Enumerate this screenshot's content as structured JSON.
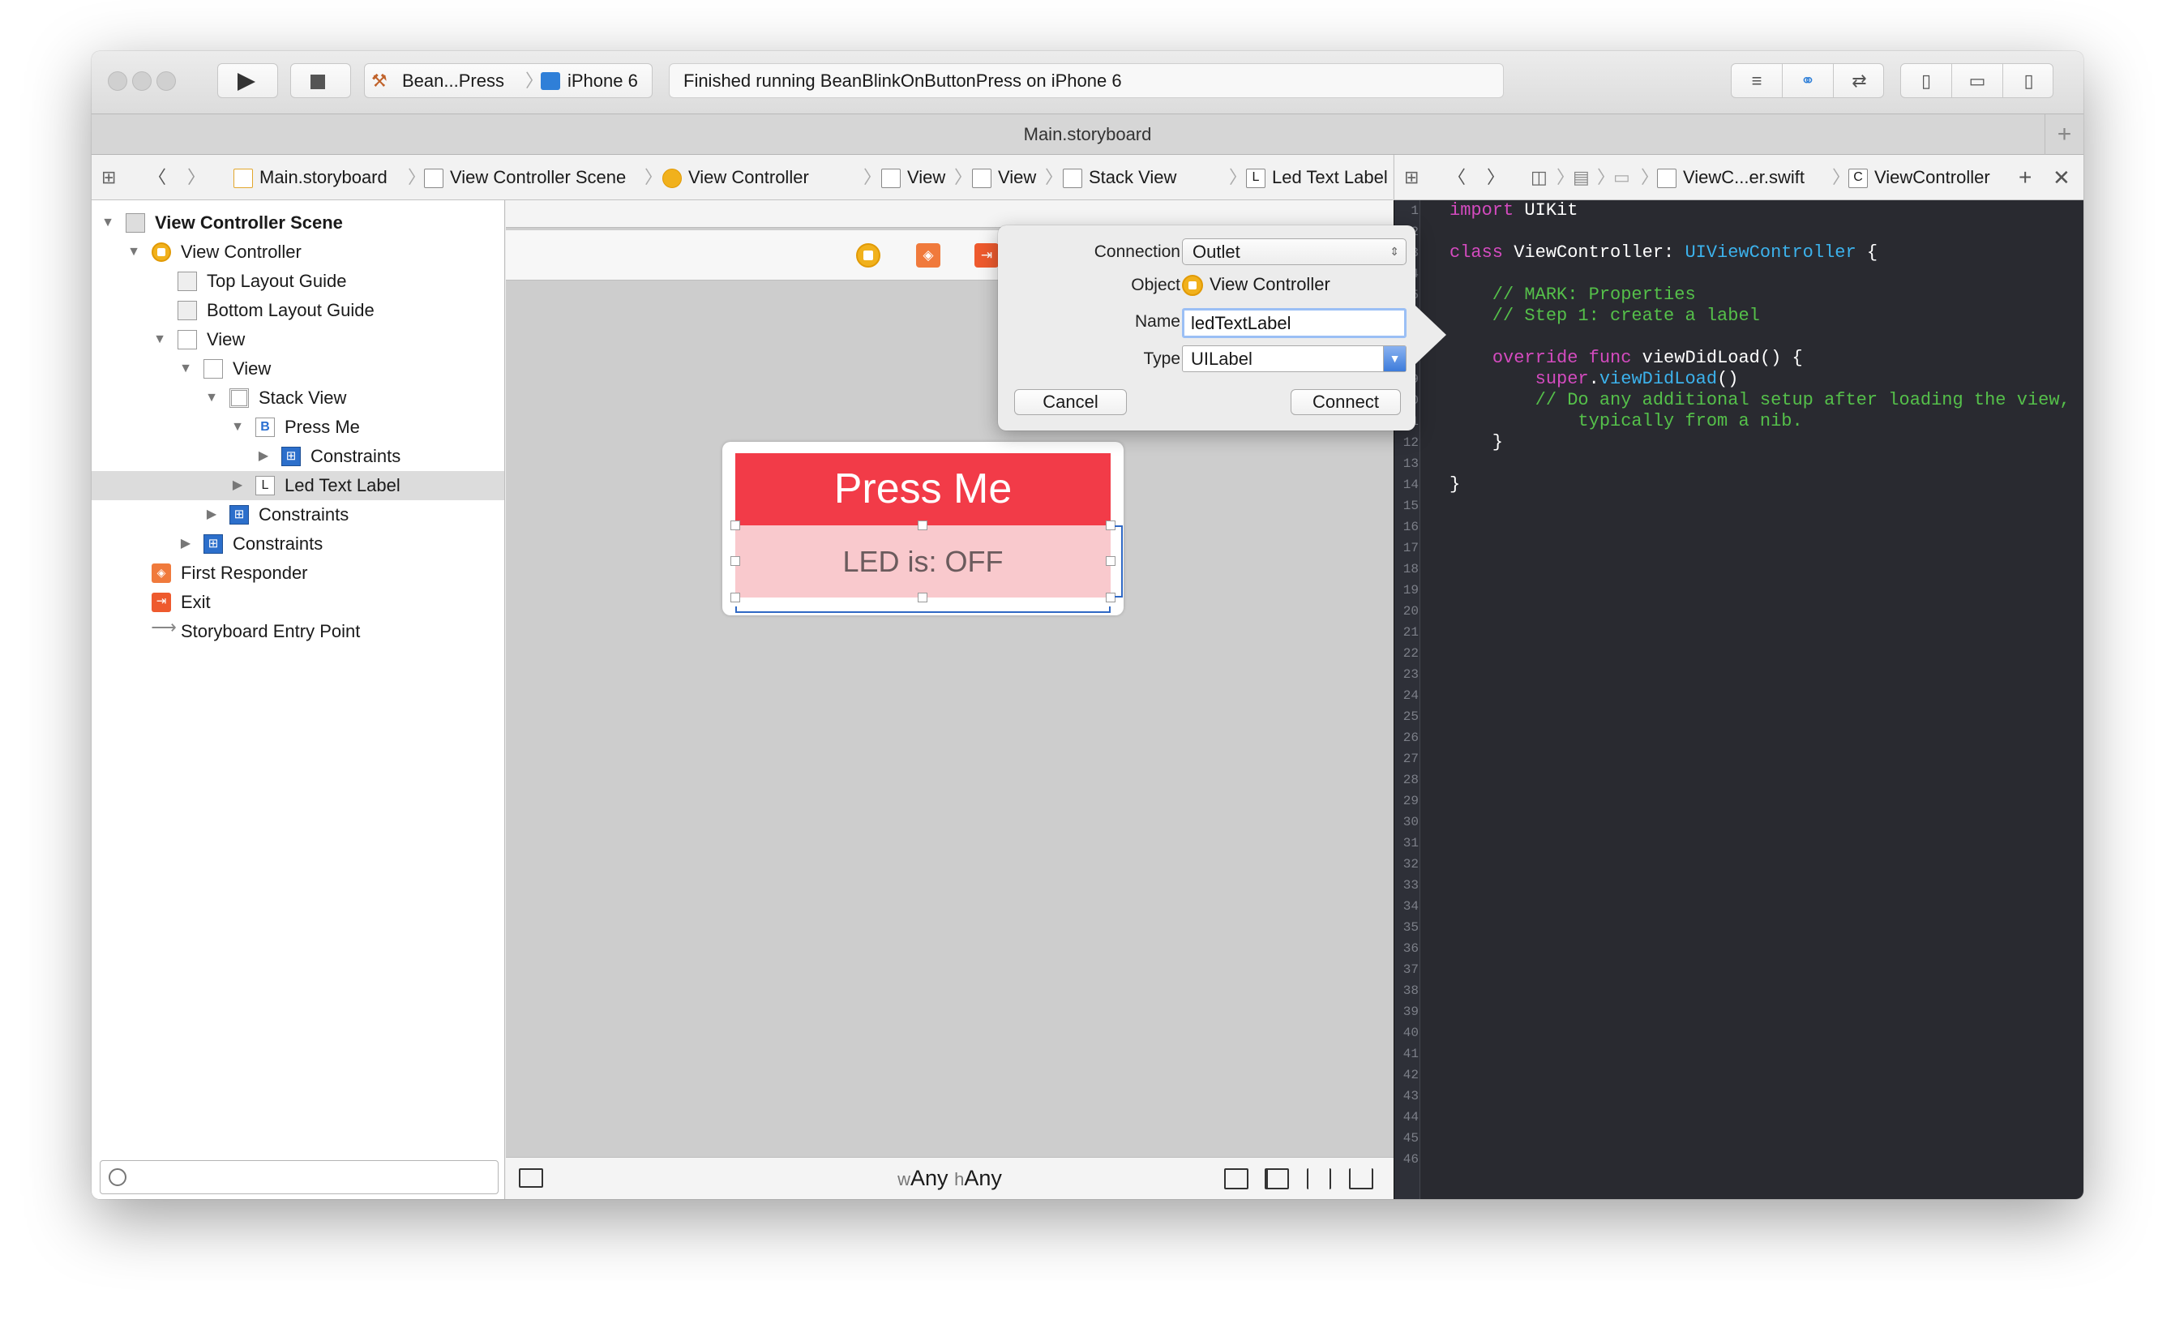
{
  "toolbar": {
    "scheme": "Bean...Press",
    "device": "iPhone 6",
    "status": "Finished running BeanBlinkOnButtonPress on iPhone 6"
  },
  "tab": {
    "title": "Main.storyboard",
    "plus": "+"
  },
  "jumpbar_left": {
    "items": [
      "Main.storyboard",
      "View Controller Scene",
      "View Controller",
      "View",
      "View",
      "Stack View",
      "Led Text Label"
    ]
  },
  "jumpbar_right": {
    "items": [
      "ViewC...er.swift",
      "ViewController"
    ]
  },
  "outline": {
    "items": [
      {
        "label": "View Controller Scene"
      },
      {
        "label": "View Controller"
      },
      {
        "label": "Top Layout Guide"
      },
      {
        "label": "Bottom Layout Guide"
      },
      {
        "label": "View"
      },
      {
        "label": "View"
      },
      {
        "label": "Stack View"
      },
      {
        "label": "Press Me"
      },
      {
        "label": "Constraints"
      },
      {
        "label": "Led Text Label"
      },
      {
        "label": "Constraints"
      },
      {
        "label": "Constraints"
      },
      {
        "label": "First Responder"
      },
      {
        "label": "Exit"
      },
      {
        "label": "Storyboard Entry Point"
      }
    ],
    "selected": "Led Text Label"
  },
  "canvas": {
    "button_title": "Press Me",
    "label_text": "LED is: OFF",
    "size_class": {
      "w_prefix": "w",
      "w_value": "Any",
      "h_prefix": "h",
      "h_value": "Any"
    }
  },
  "connection_popover": {
    "connection_label": "Connection",
    "connection_value": "Outlet",
    "object_label": "Object",
    "object_value": "View Controller",
    "name_label": "Name",
    "name_value": "ledTextLabel",
    "type_label": "Type",
    "type_value": "UILabel",
    "cancel": "Cancel",
    "connect": "Connect"
  },
  "code": {
    "line_count": 46,
    "lines": [
      "import UIKit",
      "",
      "class ViewController: UIViewController {",
      "",
      "    // MARK: Properties",
      "    // Step 1: create a label",
      "",
      "    override func viewDidLoad() {",
      "        super.viewDidLoad()",
      "        // Do any additional setup after loading the view,",
      "            typically from a nib.",
      "    }",
      "",
      "}"
    ]
  },
  "colors": {
    "button_red": "#f23b48",
    "label_pink": "#f9c9cd",
    "editor_bg": "#292a30",
    "keyword": "#d44bbf",
    "type": "#3cb2ec",
    "comment": "#55c04a"
  }
}
